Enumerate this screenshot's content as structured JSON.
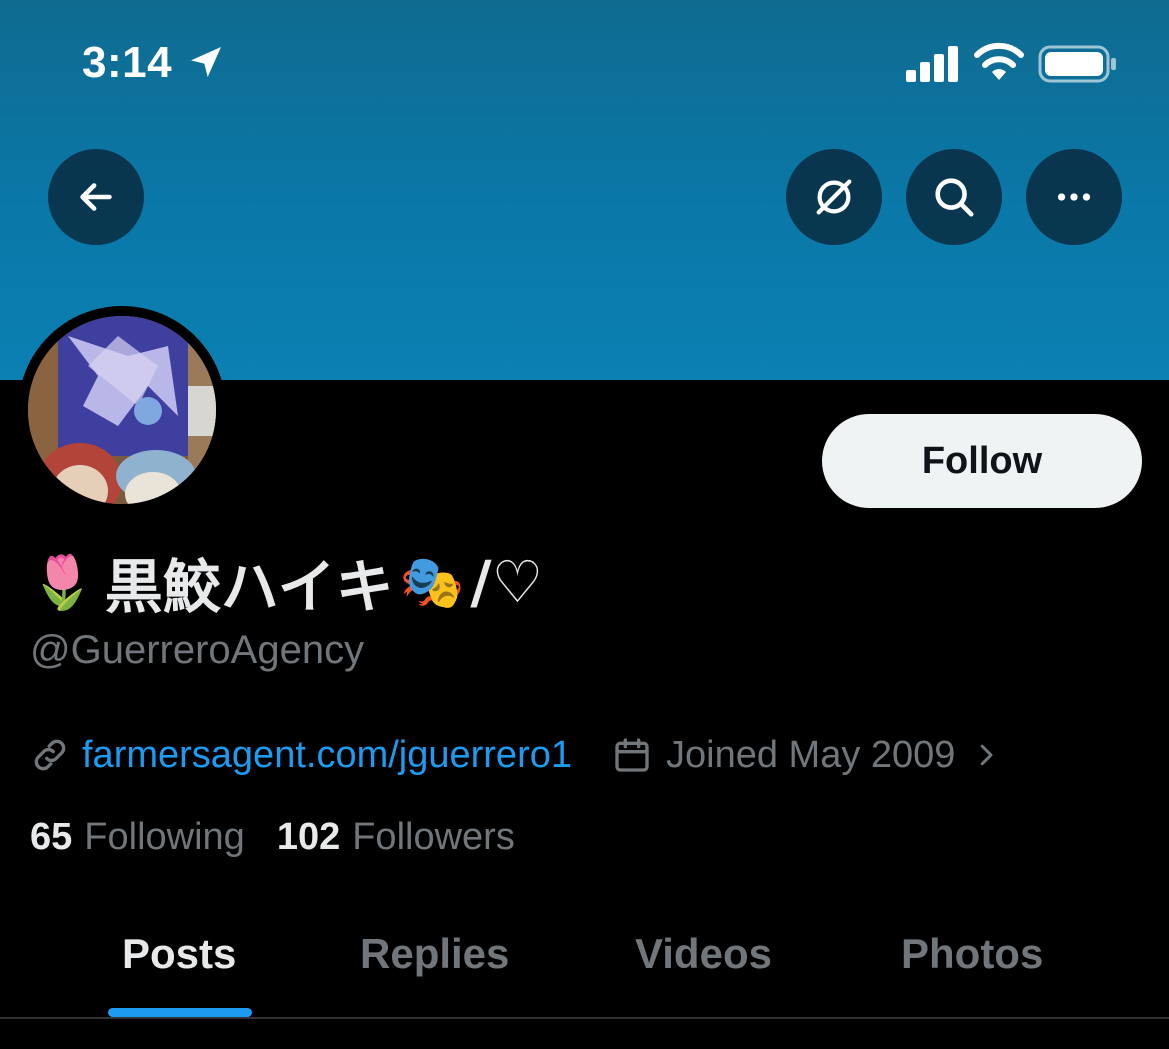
{
  "status_bar": {
    "time": "3:14",
    "icons": [
      "location-arrow-icon",
      "signal-icon",
      "wifi-icon",
      "battery-icon"
    ]
  },
  "header": {
    "buttons": [
      "back-arrow-icon",
      "grok-icon",
      "search-icon",
      "more-icon"
    ]
  },
  "profile": {
    "name_emoji_before": "🌷",
    "name_text": "黒鮫ハイキ",
    "name_emoji_after": "🎭",
    "name_suffix": "/♡",
    "handle": "@GuerreroAgency",
    "follow_label": "Follow",
    "link": "farmersagent.com/jguerrero1",
    "joined": "Joined May 2009",
    "following_count": "65",
    "following_label": "Following",
    "followers_count": "102",
    "followers_label": "Followers"
  },
  "tabs": [
    {
      "label": "Posts",
      "active": true
    },
    {
      "label": "Replies",
      "active": false
    },
    {
      "label": "Videos",
      "active": false
    },
    {
      "label": "Photos",
      "active": false
    }
  ],
  "colors": {
    "accent": "#1d9bf0",
    "background": "#000000",
    "banner": "#0a78a8",
    "muted_text": "#71767b",
    "primary_text": "#e7e9ea",
    "follow_button": "#eff3f4"
  }
}
